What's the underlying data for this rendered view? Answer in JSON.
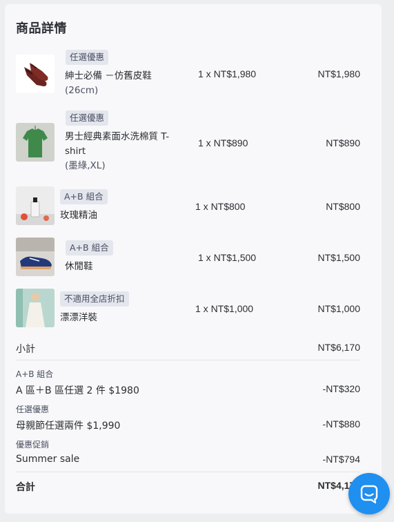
{
  "section_title": "商品詳情",
  "items": [
    {
      "tag": "任選優惠",
      "name": "紳士必備 －仿舊皮鞋",
      "variant": "(26cm)",
      "qty": "1 x NT$1,980",
      "total": "NT$1,980",
      "thumb_icon": "leather-shoe-photo"
    },
    {
      "tag": "任選優惠",
      "name": "男士經典素面水洗棉質 T-shirt",
      "variant": "(墨綠,XL)",
      "qty": "1 x NT$890",
      "total": "NT$890",
      "thumb_icon": "green-tshirt-photo"
    },
    {
      "tag": "A+B 組合",
      "name": "玫瑰精油",
      "variant": "",
      "qty": "1 x NT$800",
      "total": "NT$800",
      "thumb_icon": "rose-oil-photo"
    },
    {
      "tag": "A+B 組合",
      "name": "休閒鞋",
      "variant": "",
      "qty": "1 x NT$1,500",
      "total": "NT$1,500",
      "thumb_icon": "sneaker-photo"
    },
    {
      "tag": "不適用全店折扣",
      "name": "漂漂洋裝",
      "variant": "",
      "qty": "1 x NT$1,000",
      "total": "NT$1,000",
      "thumb_icon": "white-dress-photo"
    }
  ],
  "subtotal": {
    "label": "小計",
    "value": "NT$6,170"
  },
  "discounts": [
    {
      "category": "A+B 組合",
      "name": "A 區＋B 區任選 2 件 $1980",
      "value": "-NT$320"
    },
    {
      "category": "任選優惠",
      "name": "母親節任選兩件 $1,990",
      "value": "-NT$880"
    },
    {
      "category": "優惠促銷",
      "name": "Summer sale",
      "value": "-NT$794"
    }
  ],
  "total": {
    "label": "合計",
    "value": "NT$4,176"
  },
  "chat_button_icon": "chat-bubble-icon",
  "colors": {
    "accent": "#1f8ff0",
    "tag_bg": "#e4e6ee",
    "card_bg": "#f8f8fa"
  }
}
